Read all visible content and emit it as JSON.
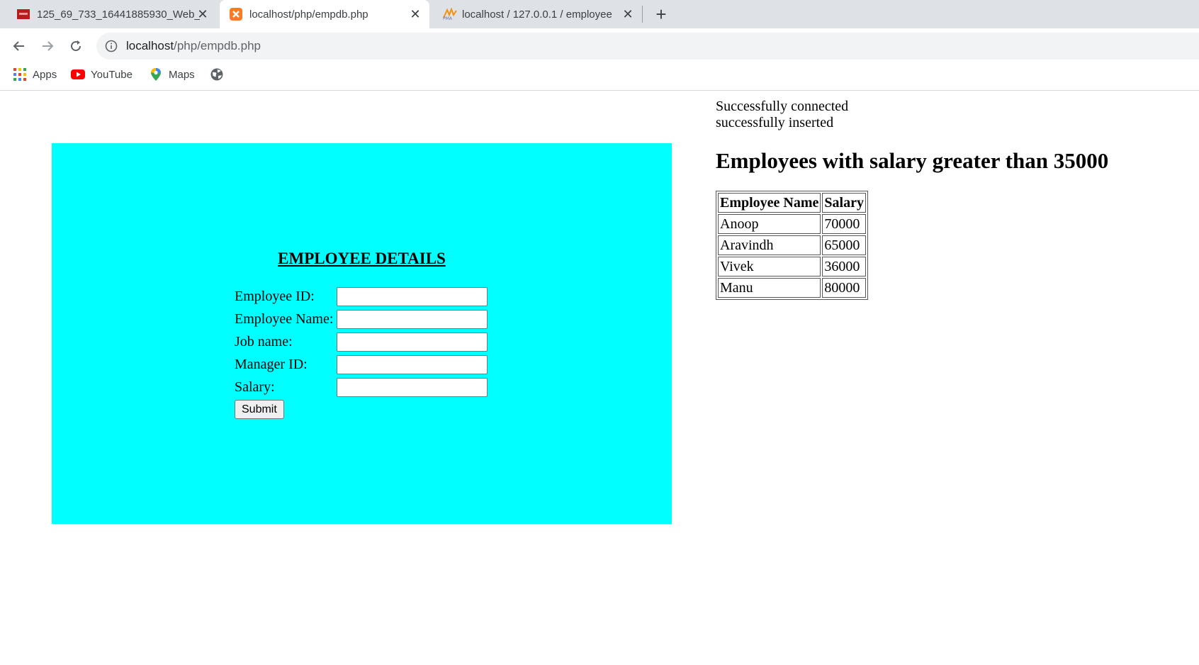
{
  "browser": {
    "tabs": [
      {
        "title": "125_69_733_16441885930_Web_",
        "close": "✕"
      },
      {
        "title": "localhost/php/empdb.php",
        "close": "✕"
      },
      {
        "title": "localhost / 127.0.0.1 / employee",
        "close": "✕"
      }
    ],
    "new_tab": "+",
    "url_host": "localhost",
    "url_path": "/php/empdb.php",
    "bookmarks": [
      {
        "label": "Apps"
      },
      {
        "label": "YouTube"
      },
      {
        "label": "Maps"
      }
    ],
    "colors": {
      "tabstrip": "#dee1e6",
      "omnibox": "#f1f3f4",
      "youtube": "#ff0000",
      "xampp": "#fb7a24"
    }
  },
  "status": {
    "line1": "Successfully connected",
    "line2": "successfully inserted"
  },
  "form": {
    "heading": "EMPLOYEE DETAILS",
    "fields": [
      {
        "label": "Employee ID:",
        "value": ""
      },
      {
        "label": "Employee Name:",
        "value": ""
      },
      {
        "label": "Job name:",
        "value": ""
      },
      {
        "label": "Manager ID:",
        "value": ""
      },
      {
        "label": "Salary:",
        "value": ""
      }
    ],
    "submit_label": "Submit",
    "background": "#00ffff"
  },
  "results": {
    "heading": "Employees with salary greater than 35000",
    "columns": [
      "Employee Name",
      "Salary"
    ],
    "rows": [
      [
        "Anoop",
        "70000"
      ],
      [
        "Aravindh",
        "65000"
      ],
      [
        "Vivek",
        "36000"
      ],
      [
        "Manu",
        "80000"
      ]
    ]
  }
}
